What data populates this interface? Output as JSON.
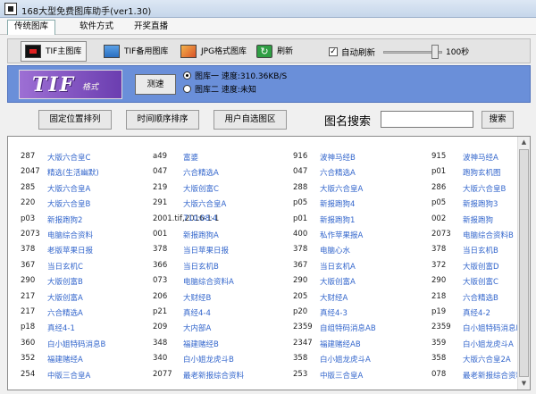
{
  "window": {
    "title": "168大型免费图库助手(ver1.30)"
  },
  "menu": [
    "传统图库",
    "软件方式",
    "开奖直播"
  ],
  "toolbar": {
    "tif_main": "TIF主图库",
    "tif_backup": "TIF备用图库",
    "jpg_format": "JPG格式图库",
    "refresh": "刷新",
    "auto_refresh": "自动刷新",
    "auto_refresh_checked": true,
    "interval": "100秒",
    "interval_seconds": 100
  },
  "panel": {
    "logo_text": "TIF",
    "logo_sub": "格式",
    "speedtest": "测速",
    "lib1": "图库一  速度:310.36KB/S",
    "lib2": "图库二  速度:未知"
  },
  "sortbar": {
    "fixed": "固定位置排列",
    "time": "时间顺序排序",
    "user": "用户自选图区",
    "search_label": "图名搜索",
    "search_value": "",
    "search_button": "搜索"
  },
  "rows": [
    [
      [
        "287",
        "大版六合皇C"
      ],
      [
        "a49",
        "富婆"
      ],
      [
        "916",
        "波神马经B"
      ],
      [
        "915",
        "波神马经A"
      ]
    ],
    [
      [
        "2047",
        "精选(生活幽默)"
      ],
      [
        "047",
        "六合精选A"
      ],
      [
        "047",
        "六合精选A"
      ],
      [
        "p01",
        "跑狗玄机图"
      ]
    ],
    [
      [
        "285",
        "大版六合皇A"
      ],
      [
        "219",
        "大版创富C"
      ],
      [
        "288",
        "大版六合皇A"
      ],
      [
        "286",
        "大版六合皇B"
      ]
    ],
    [
      [
        "220",
        "大版六合皇B"
      ],
      [
        "291",
        "大版六合皇A"
      ],
      [
        "p05",
        "新报跑狗4"
      ],
      [
        "p05",
        "新报跑狗3"
      ]
    ],
    [
      [
        "p03",
        "新报跑狗2"
      ],
      [
        "2001.tif,2016-1-1",
        "710:08:4"
      ],
      [
        "p01",
        "新报跑狗1"
      ],
      [
        "002",
        "新报跑狗"
      ]
    ],
    [
      [
        "2073",
        "电脑综合资料"
      ],
      [
        "001",
        "新报跑狗A"
      ],
      [
        "400",
        "私作苹果报A"
      ],
      [
        "2073",
        "电脑综合资料B"
      ]
    ],
    [
      [
        "378",
        "老版苹果日报"
      ],
      [
        "378",
        "当日苹果日报"
      ],
      [
        "378",
        "电脑心水"
      ],
      [
        "378",
        "当日玄机B"
      ]
    ],
    [
      [
        "367",
        "当日玄机C"
      ],
      [
        "366",
        "当日玄机B"
      ],
      [
        "367",
        "当日玄机A"
      ],
      [
        "372",
        "大版创富D"
      ]
    ],
    [
      [
        "290",
        "大版创富B"
      ],
      [
        "073",
        "电脑综合资料A"
      ],
      [
        "290",
        "大版创富A"
      ],
      [
        "290",
        "大版创富C"
      ]
    ],
    [
      [
        "217",
        "大版创富A"
      ],
      [
        "206",
        "大财经B"
      ],
      [
        "205",
        "大财经A"
      ],
      [
        "218",
        "六合精选B"
      ]
    ],
    [
      [
        "217",
        "六合精选A"
      ],
      [
        "p21",
        "真经4-4"
      ],
      [
        "p20",
        "真经4-3"
      ],
      [
        "p19",
        "真经4-2"
      ]
    ],
    [
      [
        "p18",
        "真经4-1"
      ],
      [
        "209",
        "大内部A"
      ],
      [
        "2359",
        "自组特码消息AB"
      ],
      [
        "2359",
        "白小姐特码消息B"
      ]
    ],
    [
      [
        "360",
        "白小姐特码消息B"
      ],
      [
        "348",
        "福建赌经B"
      ],
      [
        "2347",
        "福建赌经AB"
      ],
      [
        "359",
        "白小姐龙虎斗A"
      ]
    ],
    [
      [
        "352",
        "福建赌经A"
      ],
      [
        "340",
        "白小姐龙虎斗B"
      ],
      [
        "358",
        "白小姐龙虎斗A"
      ],
      [
        "358",
        "大版六合皇2A"
      ]
    ],
    [
      [
        "254",
        "中版三合皇A"
      ],
      [
        "2077",
        "最老新报综合资料"
      ],
      [
        "253",
        "中版三合皇A"
      ],
      [
        "078",
        "最老新报综合资料"
      ]
    ]
  ]
}
